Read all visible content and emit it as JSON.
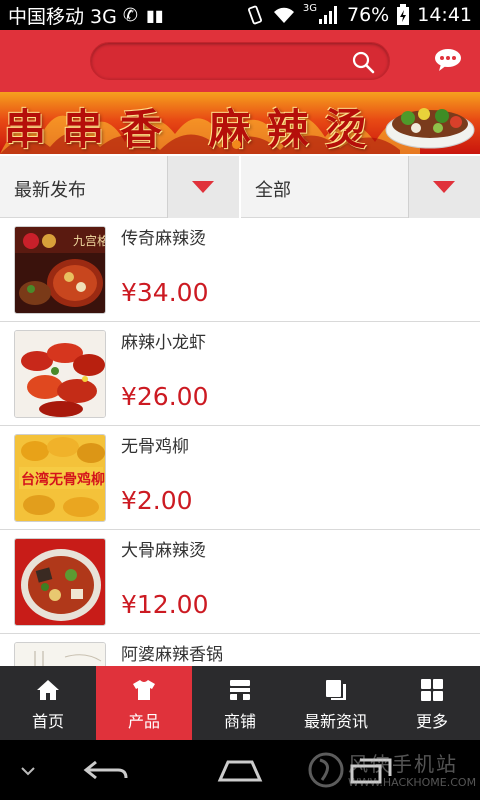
{
  "status_bar": {
    "carrier": "中国移动 3G",
    "network_badge": "3G",
    "battery": "76%",
    "time": "14:41"
  },
  "header": {
    "search_placeholder": "",
    "search_icon": "search-icon",
    "chat_icon": "chat-bubble-icon"
  },
  "banner": {
    "text": "串串香 麻辣烫",
    "active_slide": 1,
    "slide_count": 2
  },
  "filters": {
    "sort_label": "最新发布",
    "category_label": "全部"
  },
  "products": [
    {
      "name": "传奇麻辣烫",
      "price": "¥34.00"
    },
    {
      "name": "麻辣小龙虾",
      "price": "¥26.00"
    },
    {
      "name": "无骨鸡柳",
      "price": "¥2.00"
    },
    {
      "name": "大骨麻辣烫",
      "price": "¥12.00"
    },
    {
      "name": "阿婆麻辣香锅",
      "price": ""
    }
  ],
  "tabs": [
    {
      "label": "首页",
      "icon": "home-icon",
      "active": false
    },
    {
      "label": "产品",
      "icon": "shirt-icon",
      "active": true
    },
    {
      "label": "商铺",
      "icon": "store-icon",
      "active": false
    },
    {
      "label": "最新资讯",
      "icon": "news-icon",
      "active": false
    },
    {
      "label": "更多",
      "icon": "grid-icon",
      "active": false
    }
  ],
  "watermark": {
    "cn": "风侠手机站",
    "en": "WWW.HACKHOME.COM"
  },
  "colors": {
    "brand_red": "#e0323b",
    "price_red": "#cc1a22",
    "tabbar_bg": "#2b2b2d"
  }
}
